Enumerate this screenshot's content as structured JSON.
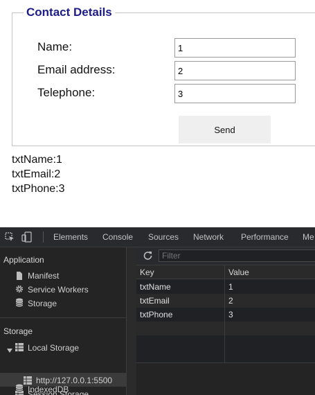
{
  "form": {
    "legend": "Contact Details",
    "fields": [
      {
        "label": "Name:",
        "value": "1"
      },
      {
        "label": "Email address:",
        "value": "2"
      },
      {
        "label": "Telephone:",
        "value": "3"
      }
    ],
    "send_label": "Send"
  },
  "output": [
    "txtName:1",
    "txtEmail:2",
    "txtPhone:3"
  ],
  "devtools": {
    "tabs": [
      "Elements",
      "Console",
      "Sources",
      "Network",
      "Performance",
      "Me"
    ],
    "application_heading": "Application",
    "application_items": [
      "Manifest",
      "Service Workers",
      "Storage"
    ],
    "storage_heading": "Storage",
    "local_storage_label": "Local Storage",
    "local_storage_origin": "http://127.0.0.1:5500",
    "session_storage_label": "Session Storage",
    "indexeddb_label": "IndexedDB",
    "filter_placeholder": "Filter",
    "table": {
      "columns": [
        "Key",
        "Value"
      ],
      "rows": [
        {
          "key": "txtName",
          "value": "1"
        },
        {
          "key": "txtEmail",
          "value": "2"
        },
        {
          "key": "txtPhone",
          "value": "3"
        }
      ]
    }
  }
}
